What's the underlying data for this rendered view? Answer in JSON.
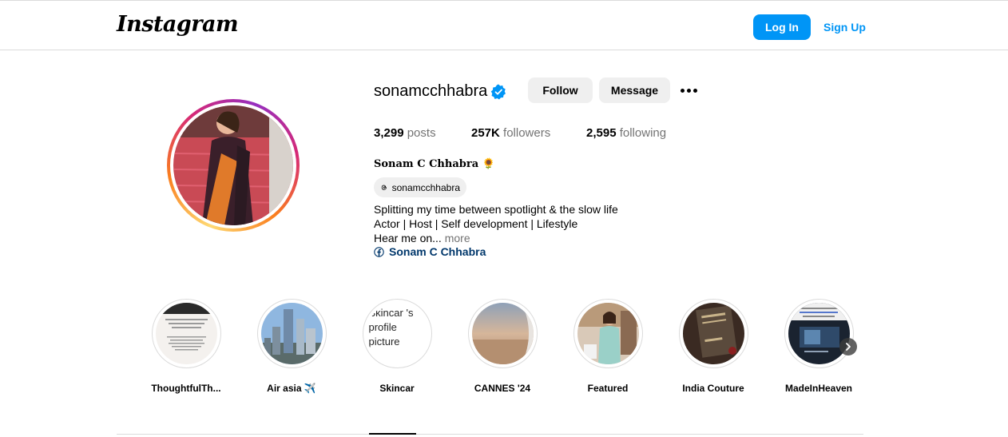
{
  "header": {
    "logo": "Instagram",
    "login_label": "Log In",
    "signup_label": "Sign Up"
  },
  "profile": {
    "username": "sonamcchhabra",
    "follow_label": "Follow",
    "message_label": "Message",
    "stats": {
      "posts_count": "3,299",
      "posts_label": "posts",
      "followers_count": "257K",
      "followers_label": "followers",
      "following_count": "2,595",
      "following_label": "following"
    },
    "full_name": "Sonam C Chhabra 🌻",
    "threads_handle": "sonamcchhabra",
    "bio_line1": "Splitting my time between spotlight & the slow life",
    "bio_line2": "Actor | Host | Self development | Lifestyle",
    "bio_line3": "Hear me on...",
    "more_label": "more",
    "facebook_link": "Sonam C Chhabra"
  },
  "highlights": [
    {
      "label": "ThoughtfulTh..."
    },
    {
      "label": "Air asia ✈️"
    },
    {
      "label": "Skincar",
      "alt_text": "Skincar 's profile picture"
    },
    {
      "label": "CANNES '24"
    },
    {
      "label": "Featured"
    },
    {
      "label": "India Couture"
    },
    {
      "label": "MadeInHeaven"
    }
  ],
  "colors": {
    "primary_blue": "#0095f6",
    "link_dark_blue": "#00376b",
    "button_gray": "#efefef",
    "muted_text": "#737373",
    "border": "#dbdbdb"
  }
}
